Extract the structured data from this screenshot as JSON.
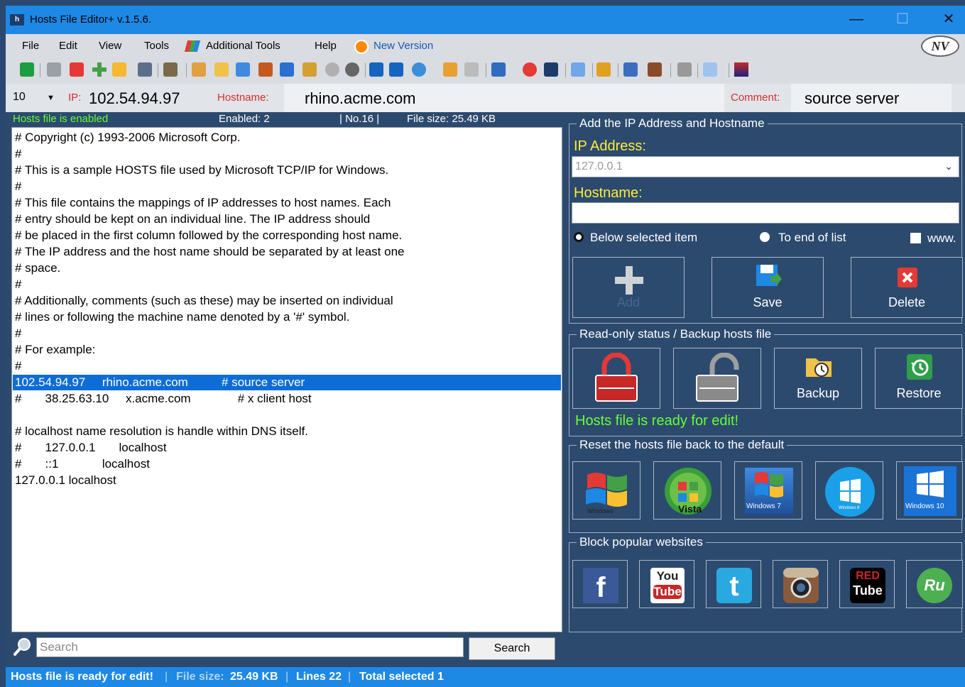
{
  "window": {
    "title": "Hosts File Editor+ v.1.5.6.",
    "app_icon": "h",
    "minimize": "—",
    "maximize": "☐",
    "close": "✕"
  },
  "menu": {
    "items": [
      "File",
      "Edit",
      "View",
      "Tools",
      "Additional Tools",
      "Help",
      "New Version"
    ],
    "logo": "NV"
  },
  "ipbar": {
    "count": "10",
    "ip_label": "IP:",
    "ip_value": "102.54.94.97",
    "hostname_label": "Hostname:",
    "hostname_value": "rhino.acme.com",
    "comment_label": "Comment:",
    "comment_value": "source server"
  },
  "statusline": {
    "enabled_text": "Hosts file is enabled",
    "enabled_count": "Enabled: 2",
    "number": "| No.16 |",
    "file_size": "File size: 25.49 KB"
  },
  "editor": {
    "lines": [
      "# Copyright (c) 1993-2006 Microsoft Corp.",
      "#",
      "# This is a sample HOSTS file used by Microsoft TCP/IP for Windows.",
      "#",
      "# This file contains the mappings of IP addresses to host names. Each",
      "# entry should be kept on an individual line. The IP address should",
      "# be placed in the first column followed by the corresponding host name.",
      "# The IP address and the host name should be separated by at least one",
      "# space.",
      "#",
      "# Additionally, comments (such as these) may be inserted on individual",
      "# lines or following the machine name denoted by a '#' symbol.",
      "#",
      "# For example:",
      "#",
      "102.54.94.97     rhino.acme.com          # source server",
      "#       38.25.63.10     x.acme.com              # x client host",
      "",
      "# localhost name resolution is handle within DNS itself.",
      "#       127.0.0.1       localhost",
      "#       ::1             localhost",
      "127.0.0.1 localhost"
    ],
    "selected_index": 15
  },
  "search": {
    "placeholder": "Search",
    "button": "Search"
  },
  "statusbar": {
    "ready": "Hosts file is ready for edit!",
    "size_label": "File size:",
    "size_value": "25.49 KB",
    "lines": "Lines 22",
    "selected": "Total selected 1"
  },
  "add_group": {
    "legend": "Add the IP Address  and Hostname",
    "ip_label": "IP Address:",
    "ip_value": "127.0.0.1",
    "hostname_label": "Hostname:",
    "hostname_value": "",
    "radio_below": "Below selected item",
    "radio_end": "To end of list",
    "www": "www.",
    "add": "Add",
    "save": "Save",
    "delete": "Delete"
  },
  "readonly_group": {
    "legend": "Read-only status / Backup hosts file",
    "backup": "Backup",
    "restore": "Restore",
    "status": "Hosts file is ready for edit!"
  },
  "reset_group": {
    "legend": "Reset the hosts file back to the default",
    "win_xp": "Windows",
    "vista": "Vista",
    "win7": "Windows 7",
    "win8": "Windows 8",
    "win10": "Windows 10"
  },
  "block_group": {
    "legend": "Block popular websites",
    "facebook": "f",
    "youtube_top": "You",
    "youtube_bottom": "Tube",
    "twitter": "t",
    "redtube_top": "RED",
    "redtube_bottom": "Tube",
    "rutube": "Ru"
  },
  "colors": {
    "accent": "#1e88e5",
    "panel": "#2c4a6e",
    "selection": "#0d6cd6",
    "green": "#66ff33",
    "yellow": "#ffeb3b",
    "red": "#d32f2f"
  }
}
